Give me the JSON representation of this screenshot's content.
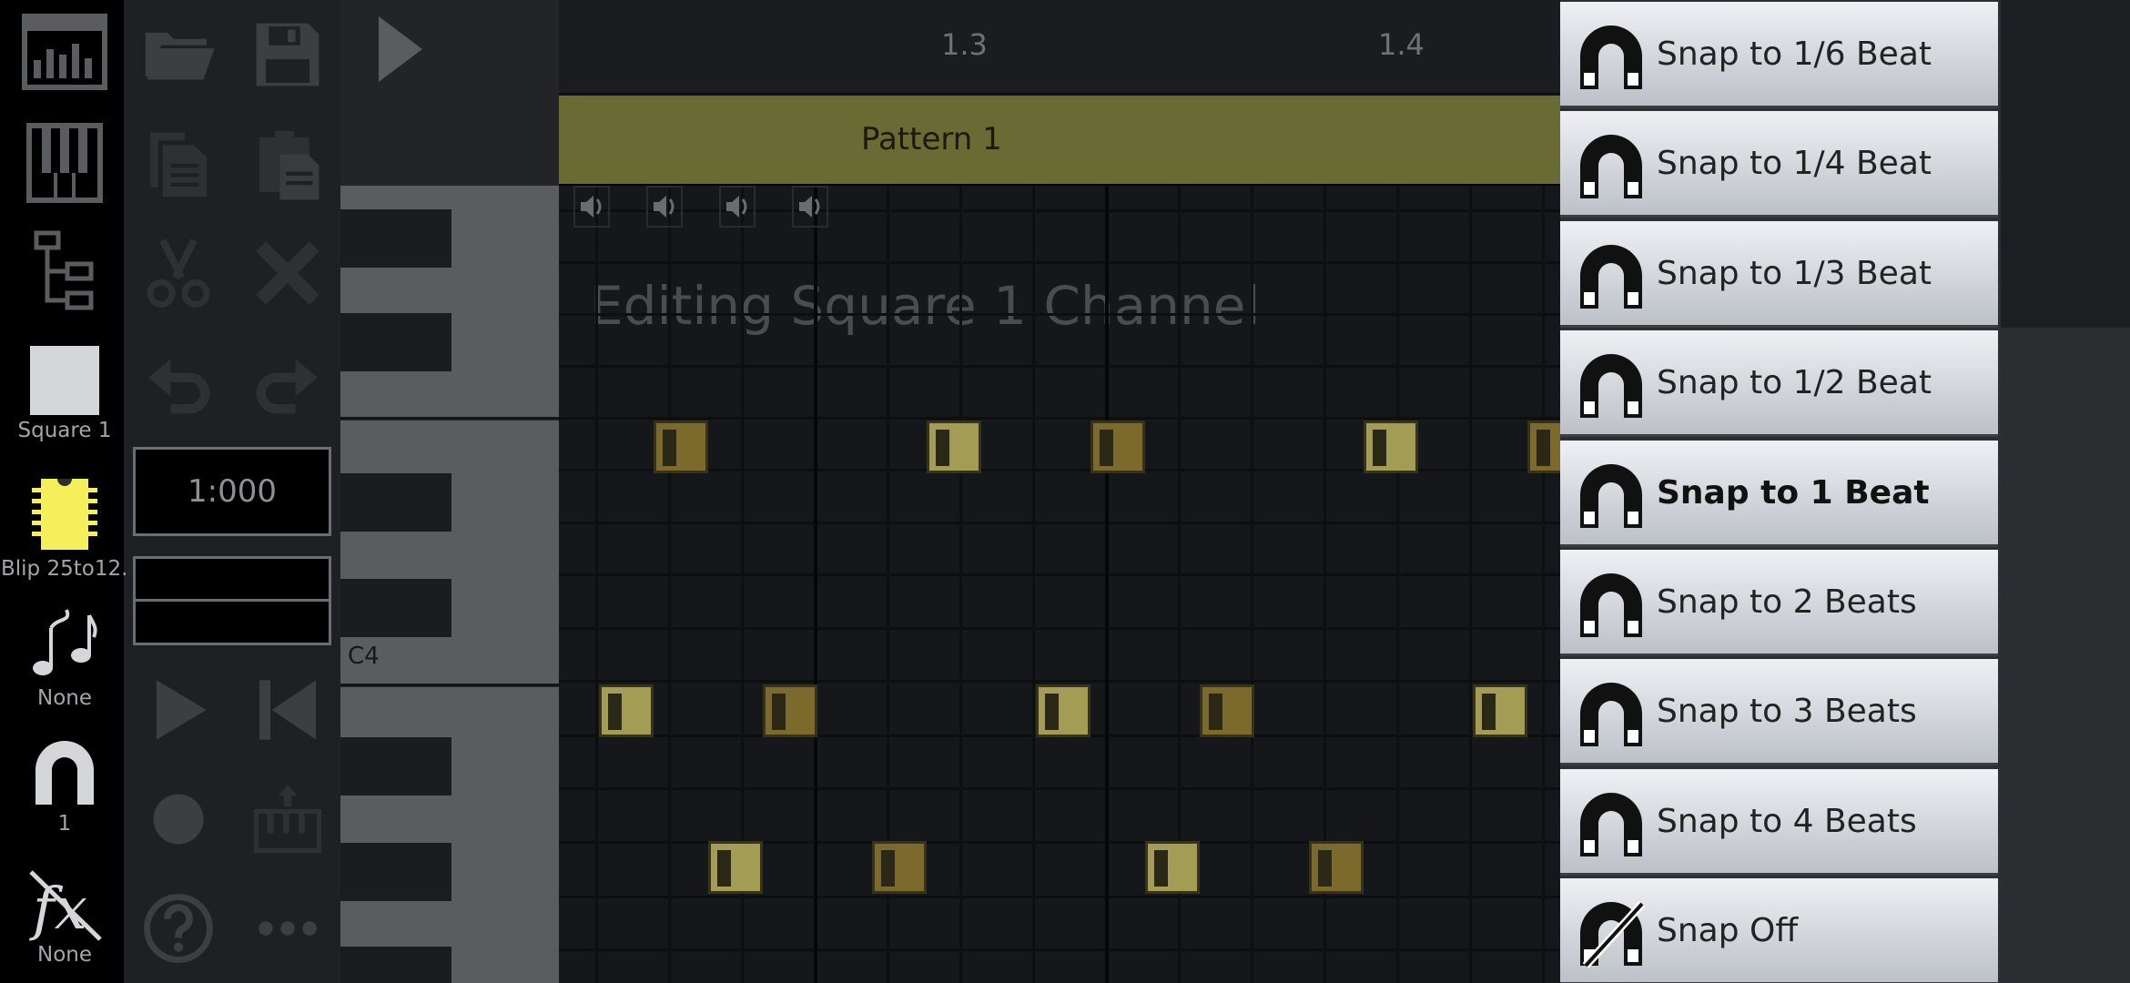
{
  "toolbar": {
    "time_display": "1:000",
    "buttons": [
      "open-file",
      "save",
      "copy",
      "paste",
      "cut",
      "delete",
      "undo",
      "redo",
      "play",
      "skip-to-start",
      "record",
      "export-midi",
      "help",
      "more"
    ]
  },
  "timeline": {
    "bar_labels": [
      "1.3",
      "1.4"
    ]
  },
  "pattern": {
    "name": "Pattern 1"
  },
  "editor": {
    "editing_label": "Editing Square 1 Channel",
    "key_label": "C4",
    "note_colors": {
      "bright": "#a29c55",
      "dark": "#7c6a2c"
    }
  },
  "snap_menu": {
    "items": [
      {
        "label": "Snap to 1/6 Beat",
        "selected": false
      },
      {
        "label": "Snap to 1/4 Beat",
        "selected": false
      },
      {
        "label": "Snap to 1/3 Beat",
        "selected": false
      },
      {
        "label": "Snap to 1/2 Beat",
        "selected": false
      },
      {
        "label": "Snap to 1 Beat",
        "selected": true
      },
      {
        "label": "Snap to 2 Beats",
        "selected": false
      },
      {
        "label": "Snap to 3 Beats",
        "selected": false
      },
      {
        "label": "Snap to 4 Beats",
        "selected": false
      },
      {
        "label": "Snap Off",
        "selected": false
      }
    ]
  },
  "right_panel": {
    "channel_name": "Square 1",
    "instrument_name": "Blip 25to12...",
    "arpeggio_label": "None",
    "snap_label": "1",
    "effect_label": "None",
    "chip_color": "#f4ef5b"
  },
  "colors": {
    "pattern_bar": "#6a6a34",
    "toolbar_icon": "#37383b",
    "menu_bg_top": "#eef0f4"
  }
}
